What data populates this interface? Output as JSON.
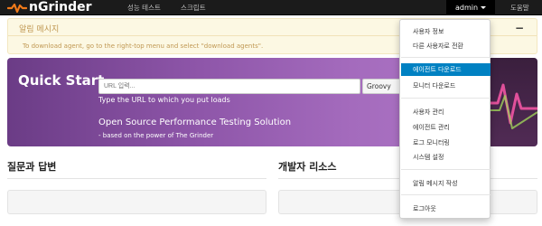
{
  "navbar": {
    "brand": "nGrinder",
    "links": [
      "성능 테스트",
      "스크립트"
    ],
    "user": "admin",
    "help": "도움말"
  },
  "alert": {
    "title": "알림 메시지",
    "message": "To download agent, go to the right-top menu and select \"download agents\".",
    "close": "−"
  },
  "hero": {
    "title": "Quick Start",
    "url_placeholder": "URL 입력...",
    "tool": "Groovy",
    "hint": "Type the URL to which you put loads",
    "subtitle": "Open Source Performance Testing Solution",
    "subtitle2": "- based on the power of The Grinder"
  },
  "sections": {
    "qna": "질문과 답변",
    "dev": "개발자 리소스"
  },
  "menu": {
    "items": [
      "사용자 정보",
      "다른 사용자로 전환",
      "에이전트 다운로드",
      "모니터 다운로드",
      "사용자 관리",
      "에이전트 관리",
      "로그 모니터링",
      "시스템 설정",
      "알림 메시지 작성",
      "로그아웃"
    ],
    "active_index": 2
  },
  "colors": {
    "brand_orange": "#f07a1a",
    "menu_active": "#0081c2",
    "hero_purple": "#8d55a8",
    "alert_text": "#c09853"
  },
  "icons": [
    "ngrinder-logo-icon",
    "caret-down-icon",
    "close-icon"
  ]
}
